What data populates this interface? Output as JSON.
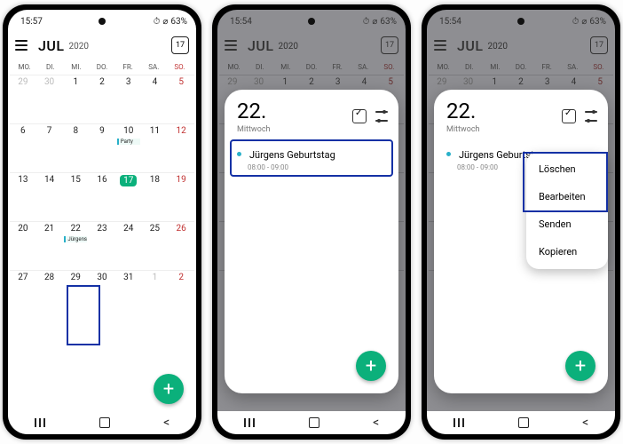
{
  "status": {
    "time1": "15:57",
    "time2": "15:54",
    "time3": "15:54",
    "battery": "63%",
    "alarm_icon": "⏰",
    "mute_icon": "🔕",
    "signal": "▮"
  },
  "header": {
    "month": "JUL",
    "year": "2020",
    "today_num": "17"
  },
  "dow": [
    "MO.",
    "DI.",
    "MI.",
    "DO.",
    "FR.",
    "SA.",
    "SO."
  ],
  "grid": [
    {
      "n": "29",
      "off": true
    },
    {
      "n": "30",
      "off": true
    },
    {
      "n": "1"
    },
    {
      "n": "2"
    },
    {
      "n": "3"
    },
    {
      "n": "4"
    },
    {
      "n": "5",
      "sun": true
    },
    {
      "n": "6"
    },
    {
      "n": "7"
    },
    {
      "n": "8"
    },
    {
      "n": "9"
    },
    {
      "n": "10",
      "ev": "Party"
    },
    {
      "n": "11"
    },
    {
      "n": "12",
      "sun": true
    },
    {
      "n": "13"
    },
    {
      "n": "14"
    },
    {
      "n": "15"
    },
    {
      "n": "16"
    },
    {
      "n": "17",
      "today": true
    },
    {
      "n": "18"
    },
    {
      "n": "19",
      "sun": true
    },
    {
      "n": "20"
    },
    {
      "n": "21"
    },
    {
      "n": "22",
      "ev": "Jürgens Ge"
    },
    {
      "n": "23"
    },
    {
      "n": "24"
    },
    {
      "n": "25"
    },
    {
      "n": "26",
      "sun": true
    },
    {
      "n": "27"
    },
    {
      "n": "28"
    },
    {
      "n": "29"
    },
    {
      "n": "30"
    },
    {
      "n": "31"
    },
    {
      "n": "1",
      "off": true
    },
    {
      "n": "2",
      "off": true,
      "sun": true
    }
  ],
  "detail": {
    "day": "22.",
    "dow": "Mittwoch",
    "event": {
      "title": "Jürgens Geburtstag",
      "time": "08:00 - 09:00"
    }
  },
  "menu": {
    "items": [
      "Löschen",
      "Bearbeiten",
      "Senden",
      "Kopieren"
    ]
  },
  "fab": {
    "label": "+"
  }
}
